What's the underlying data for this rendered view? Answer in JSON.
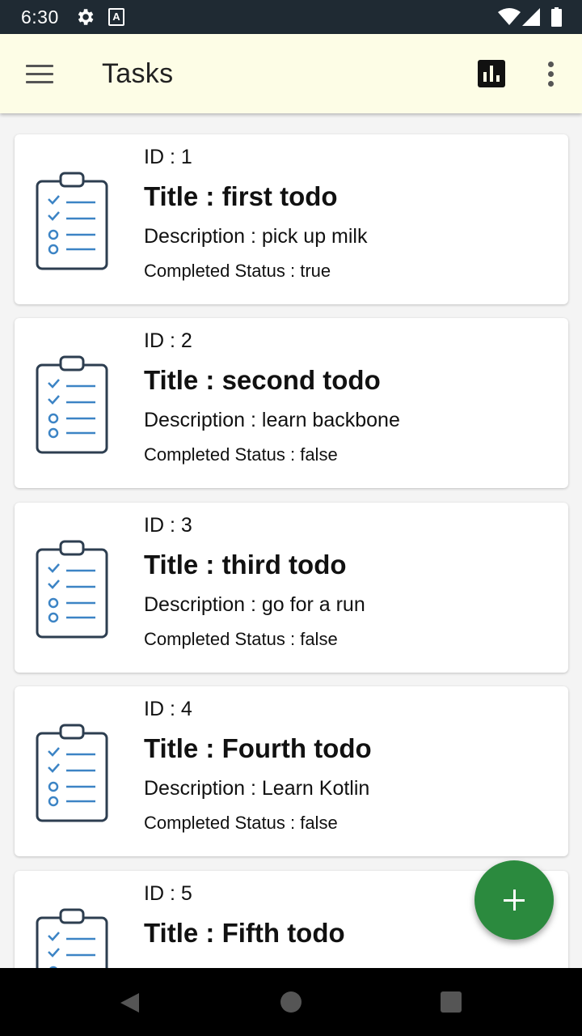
{
  "status_bar": {
    "time": "6:30",
    "icons": [
      "settings-icon",
      "a-notification-icon",
      "wifi-icon",
      "cell-signal-icon",
      "battery-icon"
    ]
  },
  "app_bar": {
    "title": "Tasks",
    "icons": [
      "hamburger-menu-icon",
      "bar-chart-icon",
      "more-vertical-icon"
    ],
    "background_color": "#fdfde6"
  },
  "tasks": [
    {
      "id": "ID : 1",
      "title": "Title : first todo",
      "description": "Description : pick up milk",
      "status": "Completed Status : true",
      "icon": "clipboard-checklist-icon"
    },
    {
      "id": "ID : 2",
      "title": "Title : second todo",
      "description": "Description : learn backbone",
      "status": "Completed Status : false",
      "icon": "clipboard-checklist-icon"
    },
    {
      "id": "ID : 3",
      "title": "Title : third todo",
      "description": "Description : go for a run",
      "status": "Completed Status : false",
      "icon": "clipboard-checklist-icon"
    },
    {
      "id": "ID : 4",
      "title": "Title : Fourth todo",
      "description": "Description : Learn Kotlin",
      "status": "Completed Status : false",
      "icon": "clipboard-checklist-icon"
    },
    {
      "id": "ID : 5",
      "title": "Title : Fifth todo",
      "description": "",
      "status": "",
      "icon": "clipboard-checklist-icon"
    }
  ],
  "fab": {
    "icon": "plus-icon",
    "color": "#2b8a3e"
  },
  "nav_bar": {
    "icons": [
      "back-icon",
      "home-icon",
      "recents-icon"
    ]
  }
}
